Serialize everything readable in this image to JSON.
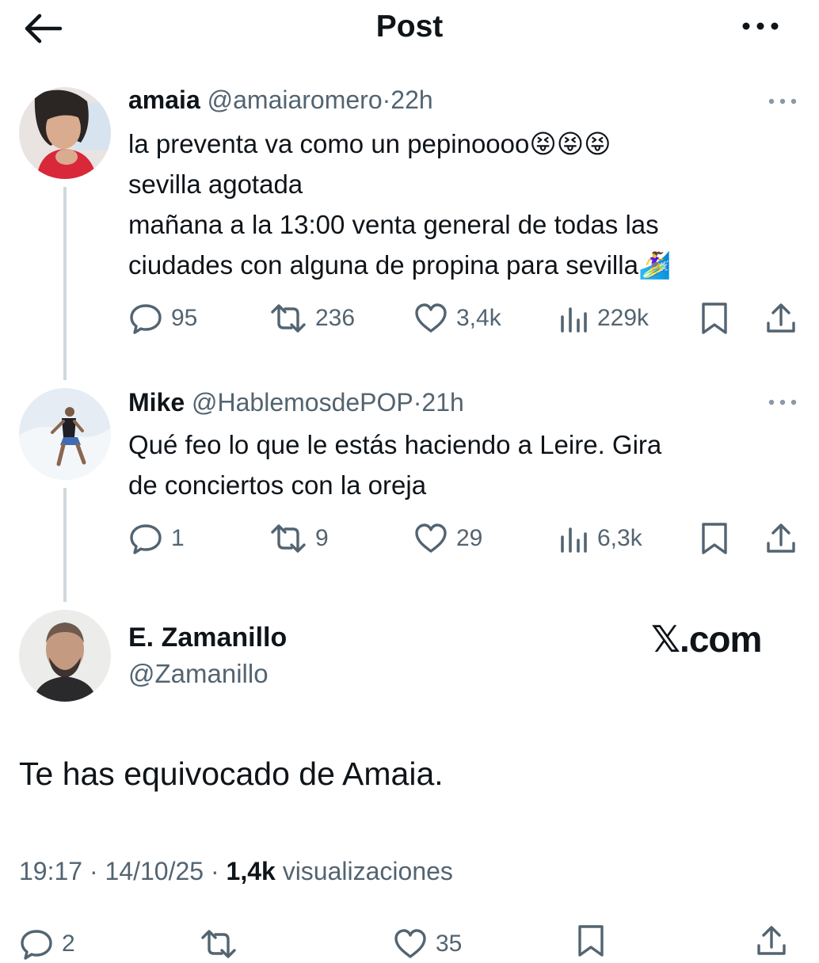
{
  "header": {
    "title": "Post"
  },
  "tweet1": {
    "name": "amaia",
    "handle": "@amaiaromero",
    "time": "22h",
    "lines": [
      "la preventa va como un pepinoooo😝😝😝",
      "sevilla agotada",
      "mañana a la 13:00 venta general de todas las",
      "ciudades con alguna de propina para sevilla🏄‍♀️"
    ],
    "replies": "95",
    "reposts": "236",
    "likes": "3,4k",
    "views": "229k"
  },
  "tweet2": {
    "name": "Mike",
    "handle": "@HablemosdePOP",
    "time": "21h",
    "lines": [
      "Qué feo lo que le estás haciendo a Leire. Gira",
      "de conciertos con la oreja"
    ],
    "replies": "1",
    "reposts": "9",
    "likes": "29",
    "views": "6,3k"
  },
  "main": {
    "name": "E. Zamanillo",
    "handle": "@Zamanillo",
    "brand": "𝕏.com",
    "text": "Te has equivocado de Amaia.",
    "timestamp": "19:17 · 14/10/25 · ",
    "views_count": "1,4k",
    "views_label": " visualizaciones",
    "replies": "2",
    "likes": "35"
  },
  "icons": {
    "back": "arrow-left-icon",
    "more": "more-horizontal-icon",
    "reply": "speech-bubble-icon",
    "repost": "repost-icon",
    "like": "heart-icon",
    "views": "bar-chart-icon",
    "bookmark": "bookmark-icon",
    "share": "share-icon"
  },
  "colors": {
    "text": "#0f1419",
    "muted": "#536471",
    "divider": "#cfd9de"
  }
}
